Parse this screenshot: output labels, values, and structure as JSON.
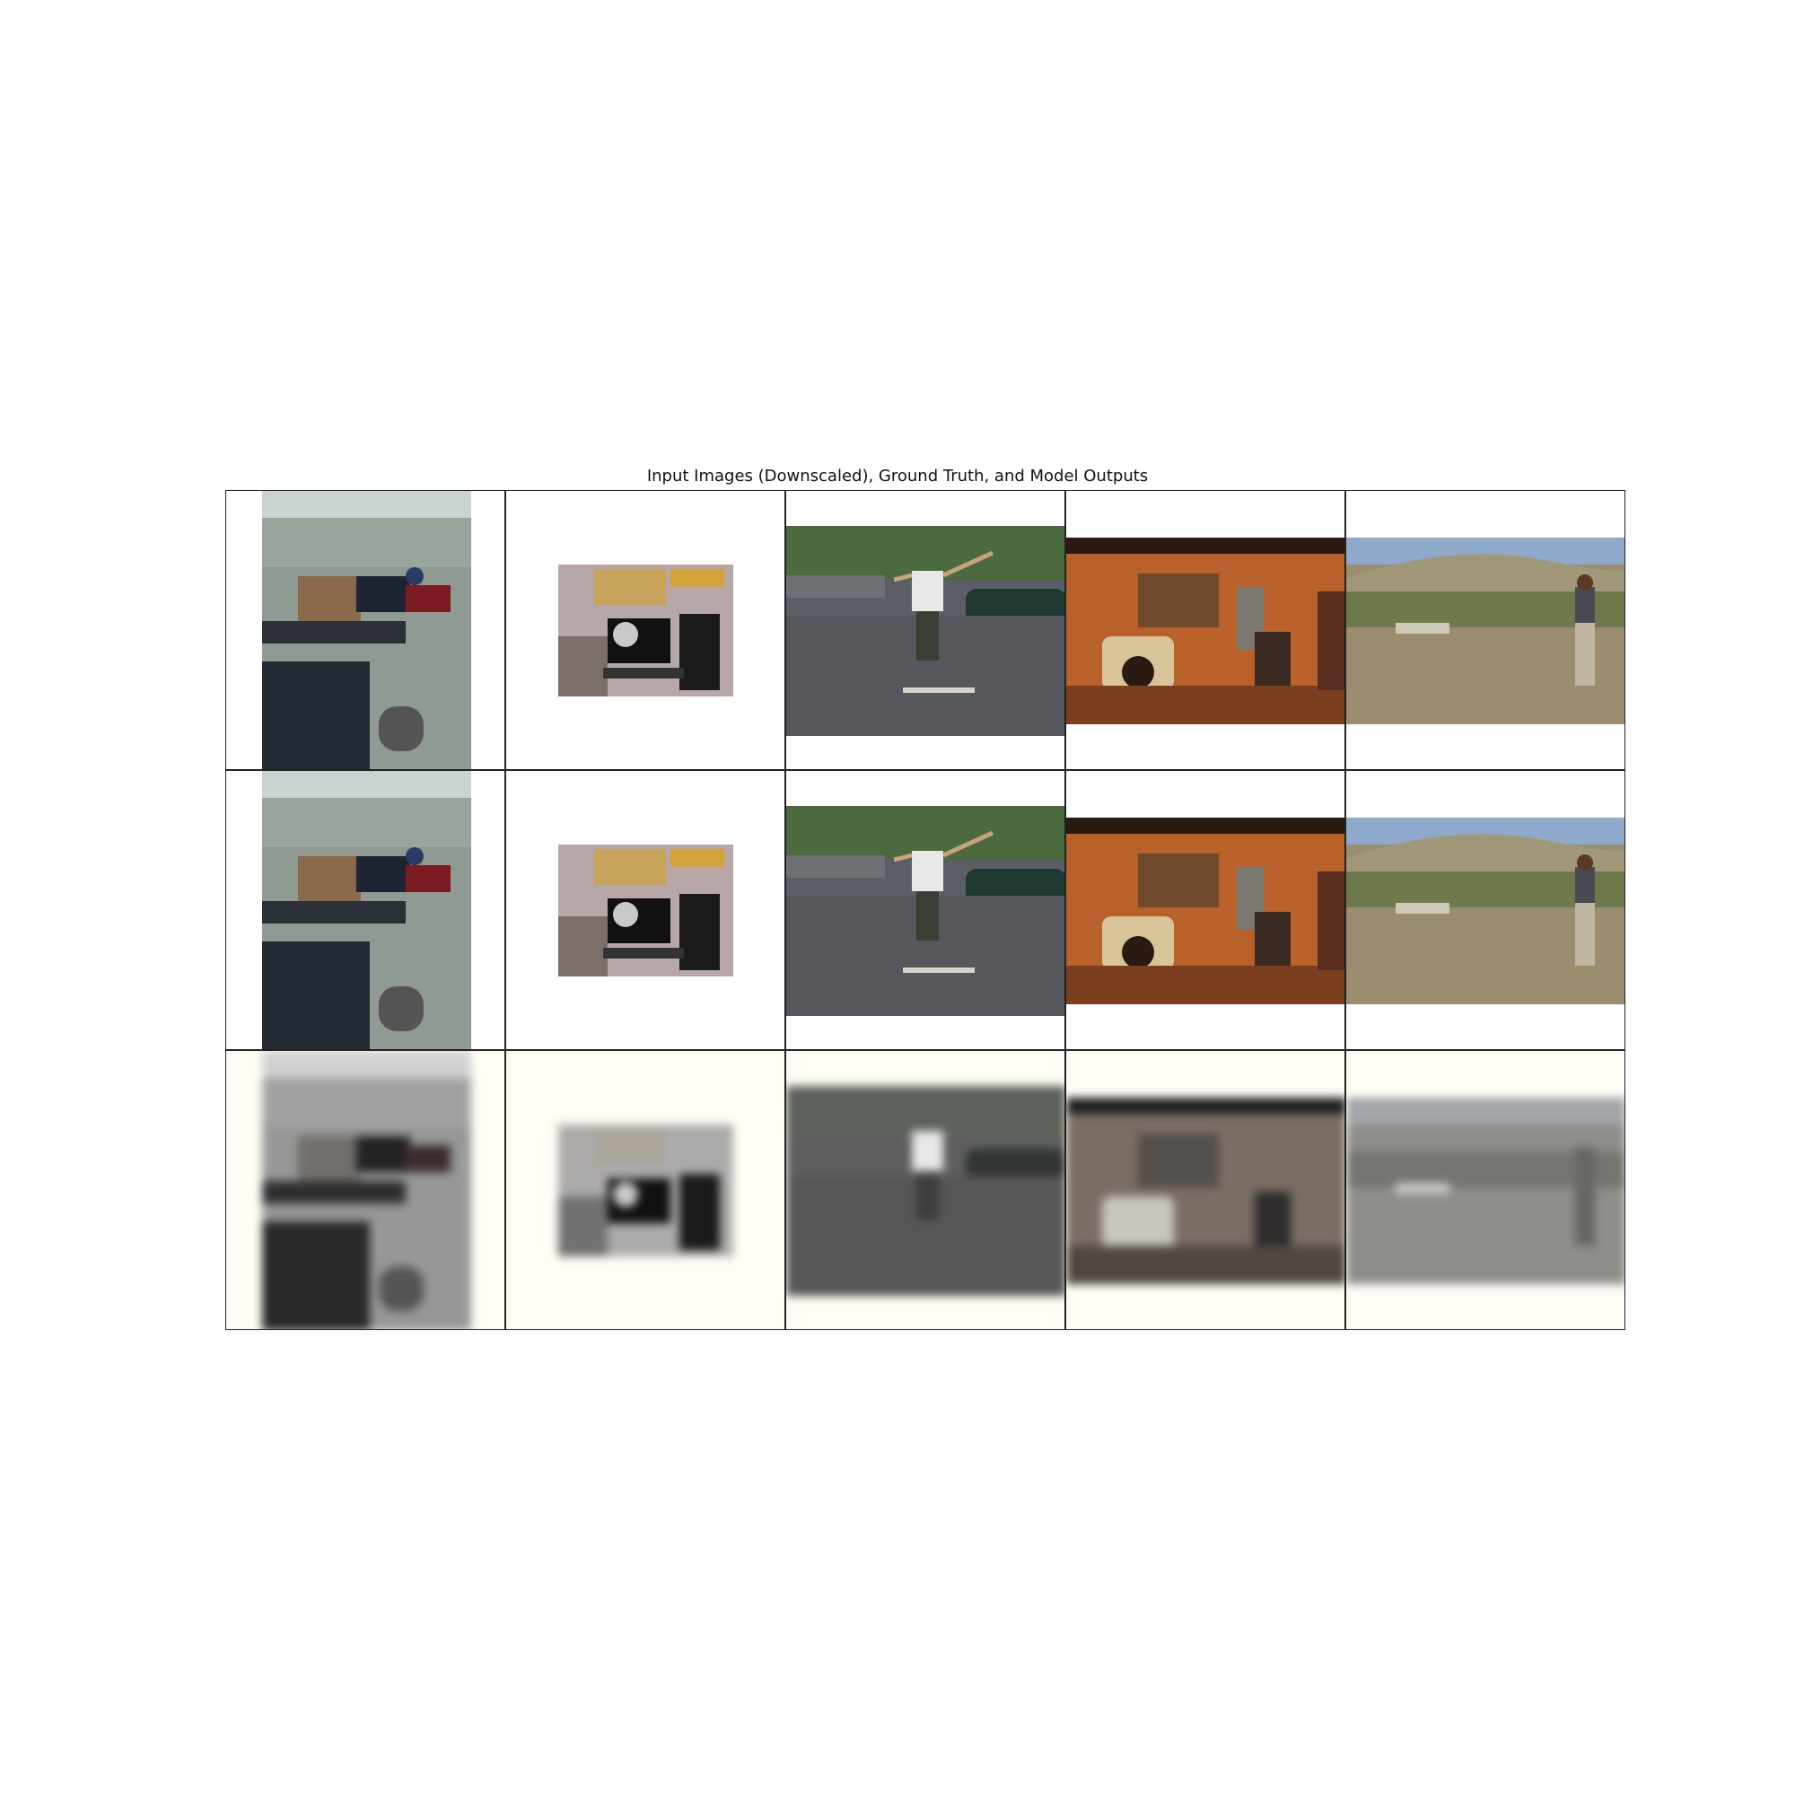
{
  "figure": {
    "title": "Input Images (Downscaled), Ground Truth, and Model Outputs"
  },
  "rows": [
    {
      "kind": "input"
    },
    {
      "kind": "ground-truth"
    },
    {
      "kind": "model-output"
    }
  ],
  "scenes": [
    {
      "name": "luggage-cart-airport-tarmac"
    },
    {
      "name": "desk-computer-monitor"
    },
    {
      "name": "skateboarder-street"
    },
    {
      "name": "orange-living-room-fireplace"
    },
    {
      "name": "boy-field-sheep"
    }
  ]
}
